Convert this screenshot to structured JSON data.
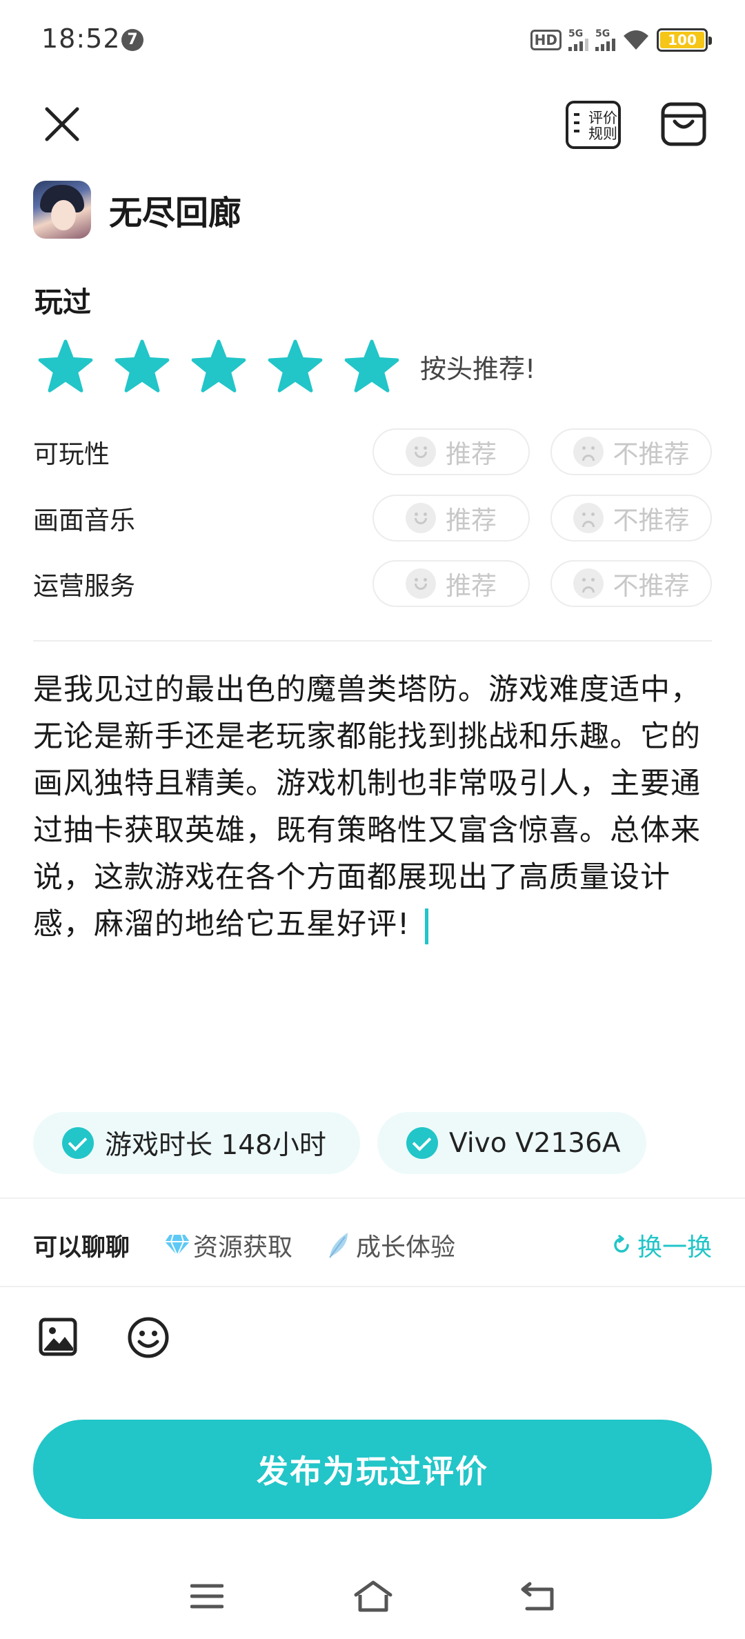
{
  "status_bar": {
    "time": "18:52",
    "notification_count": "7",
    "hd_label": "HD",
    "signal1_label": "5G",
    "signal2_label": "5G",
    "battery": "100"
  },
  "header": {
    "rules_label": "评价规则"
  },
  "game": {
    "title": "无尽回廊"
  },
  "section": {
    "played_label": "玩过"
  },
  "rating": {
    "stars": 5,
    "max_stars": 5,
    "caption": "按头推荐!"
  },
  "aspects": [
    {
      "label": "可玩性",
      "recommend": "推荐",
      "not_recommend": "不推荐"
    },
    {
      "label": "画面音乐",
      "recommend": "推荐",
      "not_recommend": "不推荐"
    },
    {
      "label": "运营服务",
      "recommend": "推荐",
      "not_recommend": "不推荐"
    }
  ],
  "review": {
    "text": "是我见过的最出色的魔兽类塔防。游戏难度适中，无论是新手还是老玩家都能找到挑战和乐趣。它的画风独特且精美。游戏机制也非常吸引人，主要通过抽卡获取英雄，既有策略性又富含惊喜。总体来说，这款游戏在各个方面都展现出了高质量设计感，麻溜的地给它五星好评!"
  },
  "tags": [
    {
      "label": "游戏时长 148小时"
    },
    {
      "label": "Vivo V2136A"
    }
  ],
  "topics": {
    "head": "可以聊聊",
    "items": [
      "资源获取",
      "成长体验"
    ],
    "refresh_label": "换一换"
  },
  "publish": {
    "label": "发布为玩过评价"
  },
  "colors": {
    "accent": "#22c5c8",
    "star": "#22c5c8",
    "battery": "#f5c518"
  }
}
